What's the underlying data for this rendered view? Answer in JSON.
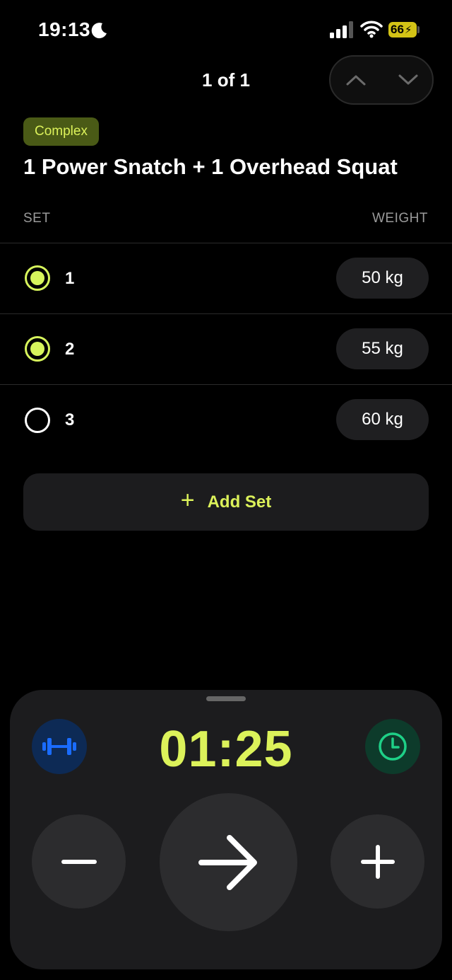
{
  "status_bar": {
    "time": "19:13",
    "battery": "66"
  },
  "header": {
    "pager": "1 of 1"
  },
  "exercise": {
    "tag": "Complex",
    "title": "1 Power Snatch + 1 Overhead Squat"
  },
  "table": {
    "col_set": "SET",
    "col_weight": "WEIGHT",
    "rows": [
      {
        "set": "1",
        "weight": "50 kg",
        "done": true
      },
      {
        "set": "2",
        "weight": "55 kg",
        "done": true
      },
      {
        "set": "3",
        "weight": "60 kg",
        "done": false
      }
    ]
  },
  "add_set": {
    "icon": "+",
    "label": "Add Set"
  },
  "timer_panel": {
    "time": "01:25",
    "left_icon": "dumbbell-icon",
    "right_icon": "clock-icon",
    "colors": {
      "accent": "#dcf25a",
      "dumbbell": "#1a6cff",
      "clock": "#1ed087"
    }
  }
}
